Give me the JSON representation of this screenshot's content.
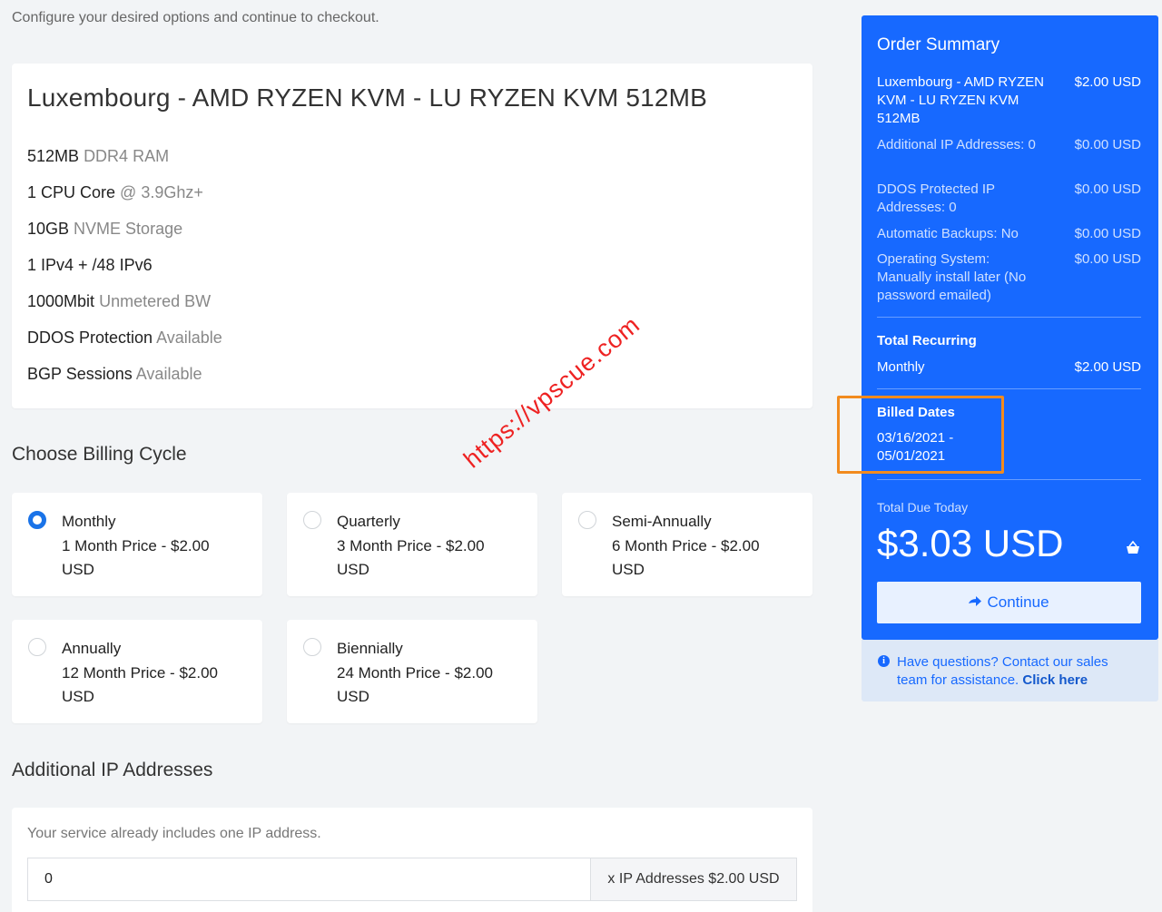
{
  "intro": "Configure your desired options and continue to checkout.",
  "product": {
    "title": "Luxembourg - AMD RYZEN KVM - LU RYZEN KVM 512MB",
    "features": [
      {
        "main": "512MB",
        "muted": "DDR4 RAM"
      },
      {
        "main": "1 CPU Core",
        "muted": "@ 3.9Ghz+"
      },
      {
        "main": "10GB",
        "muted": "NVME Storage"
      },
      {
        "main": "1 IPv4 + /48 IPv6",
        "muted": ""
      },
      {
        "main": "1000Mbit",
        "muted": "Unmetered BW"
      },
      {
        "main": "DDOS Protection",
        "muted": "Available"
      },
      {
        "main": "BGP Sessions",
        "muted": "Available"
      }
    ]
  },
  "billing": {
    "heading": "Choose Billing Cycle",
    "cycles": [
      {
        "name": "Monthly",
        "price_line": "1 Month Price - $2.00",
        "currency": "USD",
        "selected": true
      },
      {
        "name": "Quarterly",
        "price_line": "3 Month Price - $2.00",
        "currency": "USD",
        "selected": false
      },
      {
        "name": "Semi-Annually",
        "price_line": "6 Month Price - $2.00",
        "currency": "USD",
        "selected": false
      },
      {
        "name": "Annually",
        "price_line": "12 Month Price - $2.00",
        "currency": "USD",
        "selected": false
      },
      {
        "name": "Biennially",
        "price_line": "24 Month Price - $2.00",
        "currency": "USD",
        "selected": false
      }
    ]
  },
  "additional_ip": {
    "heading": "Additional IP Addresses",
    "note": "Your service already includes one IP address.",
    "value": "0",
    "addon": "x IP Addresses $2.00 USD"
  },
  "summary": {
    "title": "Order Summary",
    "product_line": {
      "label": "Luxembourg - AMD RYZEN KVM - LU RYZEN KVM 512MB",
      "amount": "$2.00 USD"
    },
    "items": [
      {
        "label": "Additional IP Addresses: 0",
        "amount": "$0.00 USD"
      },
      {
        "label": "DDOS Protected IP Addresses: 0",
        "amount": "$0.00 USD"
      },
      {
        "label": "Automatic Backups: No",
        "amount": "$0.00 USD"
      },
      {
        "label": "Operating System: Manually install later (No password emailed)",
        "amount": "$0.00 USD"
      }
    ],
    "recurring_heading": "Total Recurring",
    "recurring_label": "Monthly",
    "recurring_amount": "$2.00 USD",
    "billed_heading": "Billed Dates",
    "billed_dates": "03/16/2021 - 05/01/2021",
    "total_label": "Total Due Today",
    "total_amount": "$3.03 USD",
    "continue_label": "Continue",
    "accent_color": "#1769ff",
    "highlight_color": "#f28b1e"
  },
  "help": {
    "text": "Have questions? Contact our sales team for assistance.",
    "link": "Click here"
  },
  "watermark": "https://vpscue.com"
}
